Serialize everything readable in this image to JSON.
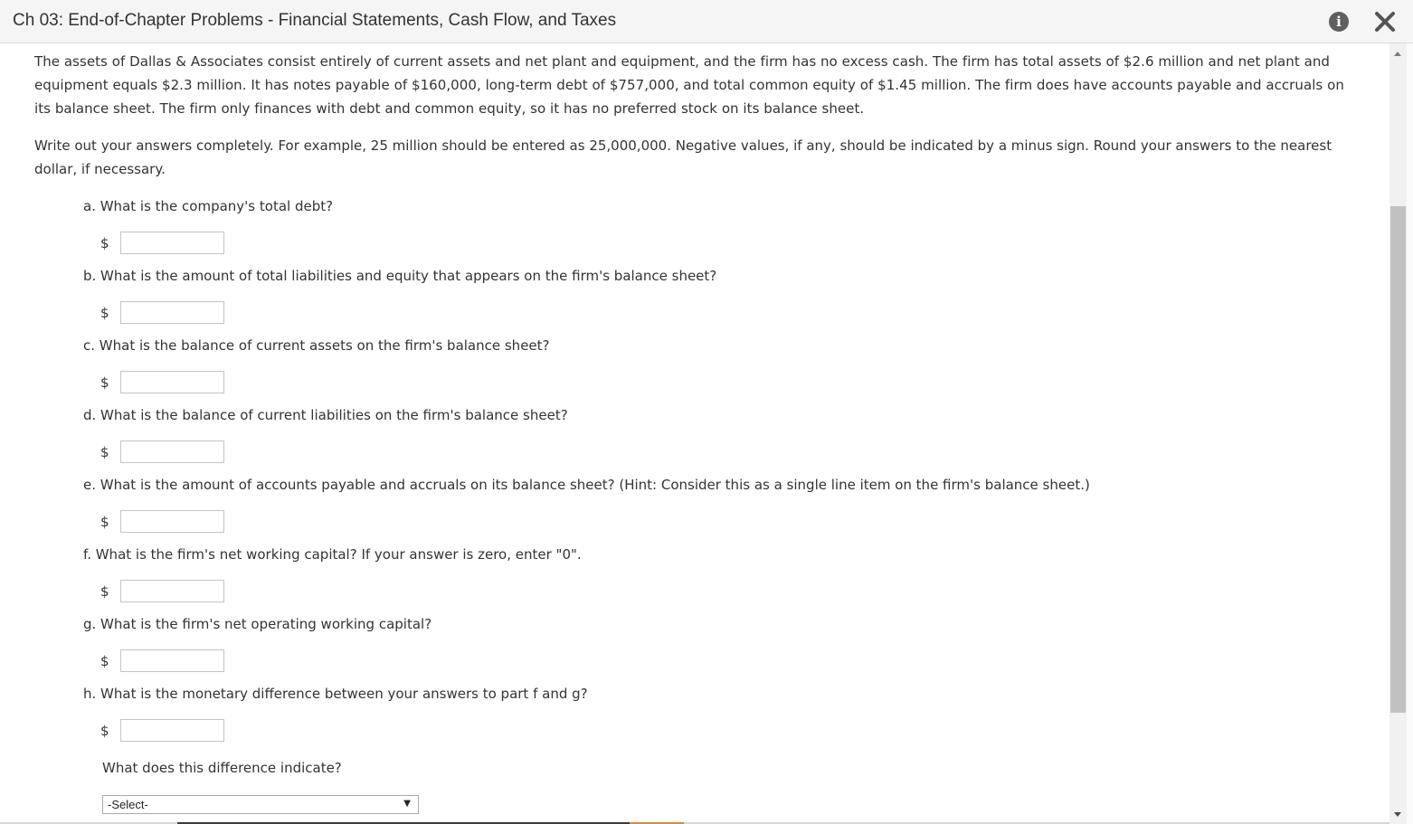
{
  "header": {
    "title": "Ch 03: End-of-Chapter Problems - Financial Statements, Cash Flow, and Taxes"
  },
  "problem": {
    "intro": "The assets of Dallas & Associates consist entirely of current assets and net plant and equipment, and the firm has no excess cash. The firm has total assets of $2.6 million and net plant and equipment equals $2.3 million. It has notes payable of $160,000, long-term debt of $757,000, and total common equity of $1.45 million. The firm does have accounts payable and accruals on its balance sheet. The firm only finances with debt and common equity, so it has no preferred stock on its balance sheet.",
    "instructions": "Write out your answers completely. For example, 25 million should be entered as 25,000,000. Negative values, if any, should be indicated by a minus sign. Round your answers to the nearest dollar, if necessary."
  },
  "questions": [
    {
      "letter": "a",
      "text": "a. What is the company's total debt?",
      "currency": "$",
      "value": ""
    },
    {
      "letter": "b",
      "text": "b. What is the amount of total liabilities and equity that appears on the firm's balance sheet?",
      "currency": "$",
      "value": ""
    },
    {
      "letter": "c",
      "text": "c. What is the balance of current assets on the firm's balance sheet?",
      "currency": "$",
      "value": ""
    },
    {
      "letter": "d",
      "text": "d. What is the balance of current liabilities on the firm's balance sheet?",
      "currency": "$",
      "value": ""
    },
    {
      "letter": "e",
      "text": "e. What is the amount of accounts payable and accruals on its balance sheet? (Hint: Consider this as a single line item on the firm's balance sheet.)",
      "currency": "$",
      "value": ""
    },
    {
      "letter": "f",
      "text": "f. What is the firm's net working capital? If your answer is zero, enter \"0\".",
      "currency": "$",
      "value": ""
    },
    {
      "letter": "g",
      "text": "g. What is the firm's net operating working capital?",
      "currency": "$",
      "value": ""
    },
    {
      "letter": "h",
      "text": "h. What is the monetary difference between your answers to part f and g?",
      "currency": "$",
      "value": ""
    }
  ],
  "followup": {
    "text": "What does this difference indicate?",
    "select_value": "-Select-"
  },
  "icons": {
    "info": "info-icon",
    "close": "close-icon"
  },
  "colors": {
    "header_bg": "#f5f5f5",
    "text": "#333333",
    "icon": "#5f5f5f",
    "scroll_thumb": "#c1c1c1"
  }
}
